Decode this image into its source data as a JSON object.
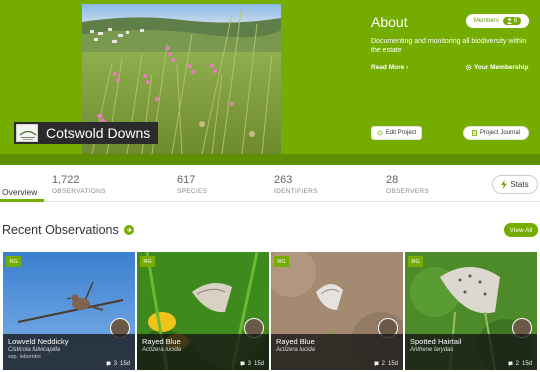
{
  "project": {
    "title": "Cotswold Downs",
    "about_title": "About",
    "members_label": "Members",
    "members_count": "8",
    "description": "Documenting and monitoring all biodiversity within the estate",
    "read_more": "Read More ›",
    "membership": "Your Membership",
    "edit_button": "Edit Project",
    "journal_button": "Project Journal",
    "accent_color": "#74ac00"
  },
  "stats": {
    "overview_tab": "Overview",
    "items": [
      {
        "num": "1,722",
        "label": "OBSERVATIONS"
      },
      {
        "num": "617",
        "label": "SPECIES"
      },
      {
        "num": "263",
        "label": "IDENTIFIERS"
      },
      {
        "num": "28",
        "label": "OBSERVERS"
      }
    ],
    "stats_button": "Stats"
  },
  "recent": {
    "title": "Recent Observations",
    "view_all": "View All",
    "cards": [
      {
        "badge": "RG",
        "name": "Lowveld Neddicky",
        "sci": "Cisticola fulvicapilla",
        "ssp": "ssp. lebombo",
        "ids": "3",
        "age": "15d"
      },
      {
        "badge": "RG",
        "name": "Rayed Blue",
        "sci": "Actizera lucida",
        "ssp": "",
        "ids": "3",
        "age": "15d"
      },
      {
        "badge": "RG",
        "name": "Rayed Blue",
        "sci": "Actizera lucida",
        "ssp": "",
        "ids": "2",
        "age": "15d"
      },
      {
        "badge": "RG",
        "name": "Spotted Hairtail",
        "sci": "Anthene larydas",
        "ssp": "",
        "ids": "2",
        "age": "15d"
      }
    ]
  }
}
